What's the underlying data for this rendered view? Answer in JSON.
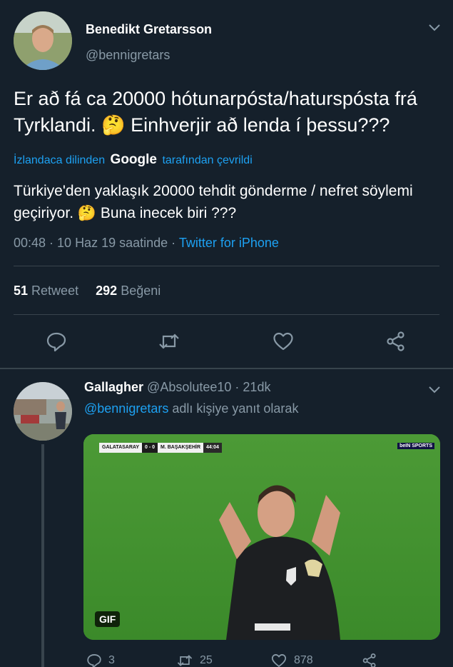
{
  "main_tweet": {
    "author_name": "Benedikt Gretarsson",
    "author_handle": "@bennigretars",
    "text": "Er að fá ca 20000 hótunarpósta/haturspósta frá Tyrklandi. 🤔 Einhverjir að lenda í þessu???",
    "translation_prefix": "İzlandaca dilinden",
    "translation_brand": "Google",
    "translation_suffix": "tarafından çevrildi",
    "translation_text": "Türkiye'den yaklaşık 20000 tehdit gönderme / nefret söylemi geçiriyor. 🤔 Buna inecek biri ???",
    "timestamp": "00:48 · 10 Haz 19 saatinde · ",
    "source": "Twitter for iPhone",
    "retweet_count": "51",
    "retweet_label": "Retweet",
    "like_count": "292",
    "like_label": "Beğeni"
  },
  "reply_tweet": {
    "author_name": "Gallagher",
    "author_handle": "@Absolutee10",
    "time_ago": "· 21dk",
    "mention": "@bennigretars",
    "reply_label": "adlı kişiye yanıt olarak",
    "gif_label": "GIF",
    "gif_scoreboard": {
      "home": "GALATASARAY",
      "score": "0 - 0",
      "away": "M. BAŞAKŞEHİR",
      "clock": "44:04"
    },
    "gif_channel": "beIN SPORTS",
    "reply_count": "3",
    "retweet_count": "25",
    "like_count": "878"
  },
  "colors": {
    "background": "#15202b",
    "accent": "#1da1f2",
    "secondary_text": "#8899a6",
    "divider": "#38444d"
  }
}
